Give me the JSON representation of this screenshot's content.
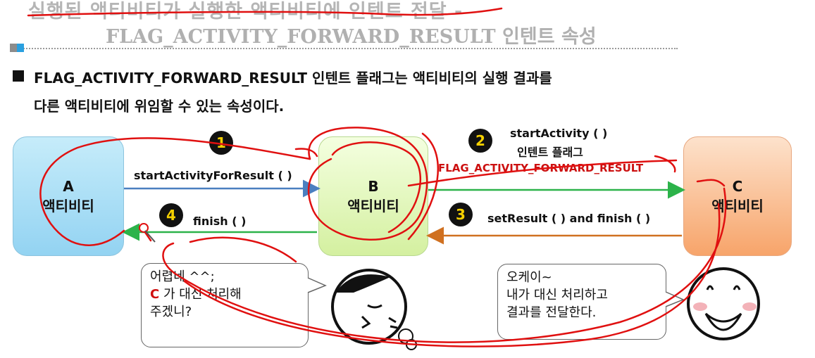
{
  "slide": {
    "title_line1": "실행된 액티비티가 실행한 액티비티에 인텐트 전달 -",
    "title_line2": "FLAG_ACTIVITY_FORWARD_RESULT 인텐트 속성",
    "description_line1": "FLAG_ACTIVITY_FORWARD_RESULT 인텐트 플래그는 액티비티의 실행 결과를",
    "description_line2": "다른 액티비티에 위임할 수 있는 속성이다."
  },
  "boxes": {
    "a": {
      "letter": "A",
      "label": "액티비티"
    },
    "b": {
      "letter": "B",
      "label": "액티비티"
    },
    "c": {
      "letter": "C",
      "label": "액티비티"
    }
  },
  "steps": {
    "s1": {
      "number": "1",
      "label": "startActivityForResult ( )"
    },
    "s2": {
      "number": "2",
      "label_line1": "startActivity ( )",
      "label_line2": "인텐트 플래그",
      "flag": "FLAG_ACTIVITY_FORWARD_RESULT"
    },
    "s3": {
      "number": "3",
      "label": "setResult ( ) and finish ( )"
    },
    "s4": {
      "number": "4",
      "label": "finish ( )"
    }
  },
  "bubbles": {
    "left": {
      "line1": "어렵네 ^^;",
      "line2_c": "C",
      "line2_rest": " 가 대신 처리해",
      "line3": "주겠니?"
    },
    "right": {
      "line1": "오케이~",
      "line2": "내가 대신 처리하고",
      "line3": "결과를 전달한다."
    }
  },
  "colors": {
    "arrow_blue": "#4a7fc0",
    "arrow_green": "#2cb34a",
    "arrow_orange": "#d07020",
    "annotation_red": "#e01010",
    "flag_text": "#cc1010"
  },
  "icons": [
    "sighing-face-icon",
    "smiling-face-icon"
  ]
}
